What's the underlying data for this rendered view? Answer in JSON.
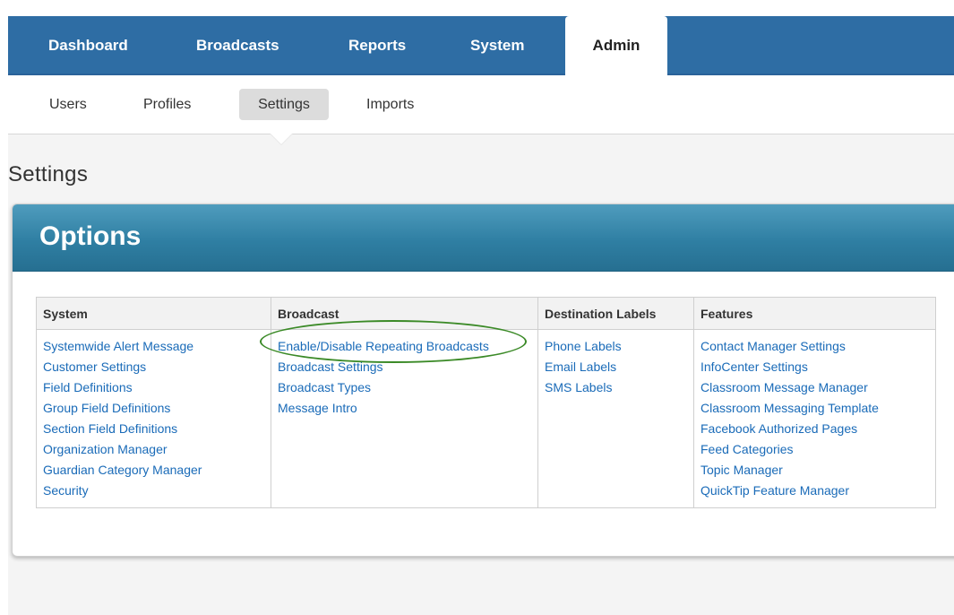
{
  "topnav": {
    "tabs": [
      {
        "label": "Dashboard"
      },
      {
        "label": "Broadcasts"
      },
      {
        "label": "Reports"
      },
      {
        "label": "System"
      },
      {
        "label": "Admin"
      }
    ],
    "active": "Admin",
    "color": "#2e6da4"
  },
  "subnav": {
    "tabs": [
      {
        "label": "Users"
      },
      {
        "label": "Profiles"
      },
      {
        "label": "Settings"
      },
      {
        "label": "Imports"
      }
    ],
    "active": "Settings"
  },
  "page": {
    "title": "Settings"
  },
  "panel": {
    "title": "Options",
    "header_color": "#2f7fa3"
  },
  "options_table": {
    "columns": [
      {
        "header": "System",
        "links": [
          "Systemwide Alert Message",
          "Customer Settings",
          "Field Definitions",
          "Group Field Definitions",
          "Section Field Definitions",
          "Organization Manager",
          "Guardian Category Manager",
          "Security"
        ]
      },
      {
        "header": "Broadcast",
        "links": [
          "Enable/Disable Repeating Broadcasts",
          "Broadcast Settings",
          "Broadcast Types",
          "Message Intro"
        ]
      },
      {
        "header": "Destination Labels",
        "links": [
          "Phone Labels",
          "Email Labels",
          "SMS Labels"
        ]
      },
      {
        "header": "Features",
        "links": [
          "Contact Manager Settings",
          "InfoCenter Settings",
          "Classroom Message Manager",
          "Classroom Messaging Template",
          "Facebook Authorized Pages",
          "Feed Categories",
          "Topic Manager",
          "QuickTip Feature Manager"
        ]
      }
    ],
    "link_color": "#1a6bb8"
  },
  "annotation": {
    "highlight_color": "#3b8a27"
  }
}
